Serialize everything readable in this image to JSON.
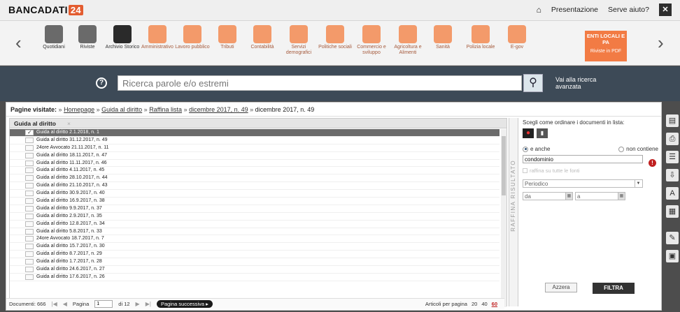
{
  "header": {
    "logo_text": "BANCADATI",
    "logo_badge": "24",
    "home_icon": "home-icon",
    "presentazione": "Presentazione",
    "serve_aiuto": "Serve aiuto?",
    "close_label": "✕"
  },
  "categories": [
    {
      "label": "Quotidiani"
    },
    {
      "label": "Riviste"
    },
    {
      "label": "Archivio Storico"
    },
    {
      "label": "Amministrativo"
    },
    {
      "label": "Lavoro pubblico"
    },
    {
      "label": "Tributi"
    },
    {
      "label": "Contabilità"
    },
    {
      "label": "Servizi demografici"
    },
    {
      "label": "Politiche sociali"
    },
    {
      "label": "Commercio e sviluppo"
    },
    {
      "label": "Agricoltura e Alimenti"
    },
    {
      "label": "Sanità"
    },
    {
      "label": "Polizia locale"
    },
    {
      "label": "E-gov"
    }
  ],
  "enti": {
    "title": "ENTI LOCALI E PA",
    "sub": "Riviste in PDF"
  },
  "search": {
    "placeholder": "Ricerca parole e/o estremi",
    "advanced": "Vai alla ricerca avanzata"
  },
  "visited": {
    "title": "Pagine visitate:",
    "crumbs": [
      "Homepage",
      "Guida al diritto",
      "Raffina lista",
      "dicembre 2017, n. 49"
    ],
    "current": "dicembre 2017, n. 49"
  },
  "list": {
    "tab_label": "Guida al diritto",
    "rows": [
      "Guida al diritto 2.1.2018, n. 1",
      "Guida al diritto 31.12.2017, n. 49",
      "24ore Avvocato 21.11.2017, n. 11",
      "Guida al diritto 18.11.2017, n. 47",
      "Guida al diritto 11.11.2017, n. 46",
      "Guida al diritto 4.11.2017, n. 45",
      "Guida al diritto 28.10.2017, n. 44",
      "Guida al diritto 21.10.2017, n. 43",
      "Guida al diritto 30.9.2017, n. 40",
      "Guida al diritto 16.9.2017, n. 38",
      "Guida al diritto 9.9.2017, n. 37",
      "Guida al diritto 2.9.2017, n. 35",
      "Guida al diritto 12.8.2017, n. 34",
      "Guida al diritto 5.8.2017, n. 33",
      "24ore Avvocato 18.7.2017, n. 7",
      "Guida al diritto 15.7.2017, n. 30",
      "Guida al diritto 8.7.2017, n. 29",
      "Guida al diritto 1.7.2017, n. 28",
      "Guida al diritto 24.6.2017, n. 27",
      "Guida al diritto 17.6.2017, n. 26"
    ]
  },
  "raffina_label": "RAFFINA RISULTATO",
  "filter": {
    "order_hdr": "Scegli come ordinare i documenti in lista:",
    "opt_e_anche": "e anche",
    "opt_non_contiene": "non contiene",
    "term_value": "condominio",
    "refine_all": "raffina su tutte le fonti",
    "periodico": "Periodico",
    "date_from": "da",
    "date_to": "a",
    "azzera": "Azzera",
    "filtra": "FILTRA"
  },
  "bottom": {
    "documenti": "Documenti: 666",
    "pagina_label": "Pagina",
    "pagina_value": "1",
    "di": "di 12",
    "pagina_successiva": "Pagina successiva",
    "per_page_label": "Articoli per pagina",
    "pp20": "20",
    "pp40": "40",
    "pp60": "60"
  }
}
